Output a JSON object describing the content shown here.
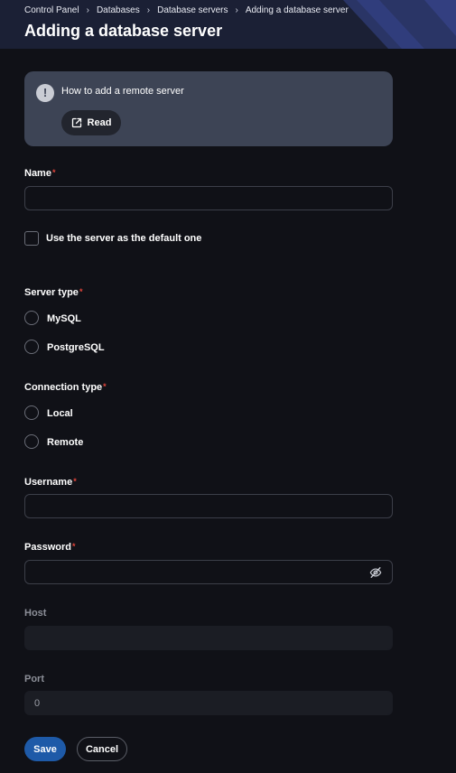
{
  "breadcrumb": {
    "items": [
      "Control Panel",
      "Databases",
      "Database servers",
      "Adding a database server"
    ]
  },
  "page": {
    "title": "Adding a database server"
  },
  "info": {
    "title": "How to add a remote server",
    "read_label": "Read"
  },
  "form": {
    "name": {
      "label": "Name",
      "value": ""
    },
    "default_checkbox": {
      "label": "Use the server as the default one",
      "checked": false
    },
    "server_type": {
      "label": "Server type",
      "options": [
        "MySQL",
        "PostgreSQL"
      ]
    },
    "connection_type": {
      "label": "Connection type",
      "options": [
        "Local",
        "Remote"
      ]
    },
    "username": {
      "label": "Username",
      "value": ""
    },
    "password": {
      "label": "Password",
      "value": ""
    },
    "host": {
      "label": "Host",
      "value": ""
    },
    "port": {
      "label": "Port",
      "value": "0"
    },
    "required_mark": "*"
  },
  "actions": {
    "save_label": "Save",
    "cancel_label": "Cancel"
  },
  "icons": {
    "info": "exclamation-icon",
    "read": "external-link-icon",
    "password_toggle": "eye-off-icon"
  },
  "colors": {
    "accent": "#1e5aa8",
    "required": "#e4463c",
    "card": "#3d4455",
    "background": "#101117"
  }
}
